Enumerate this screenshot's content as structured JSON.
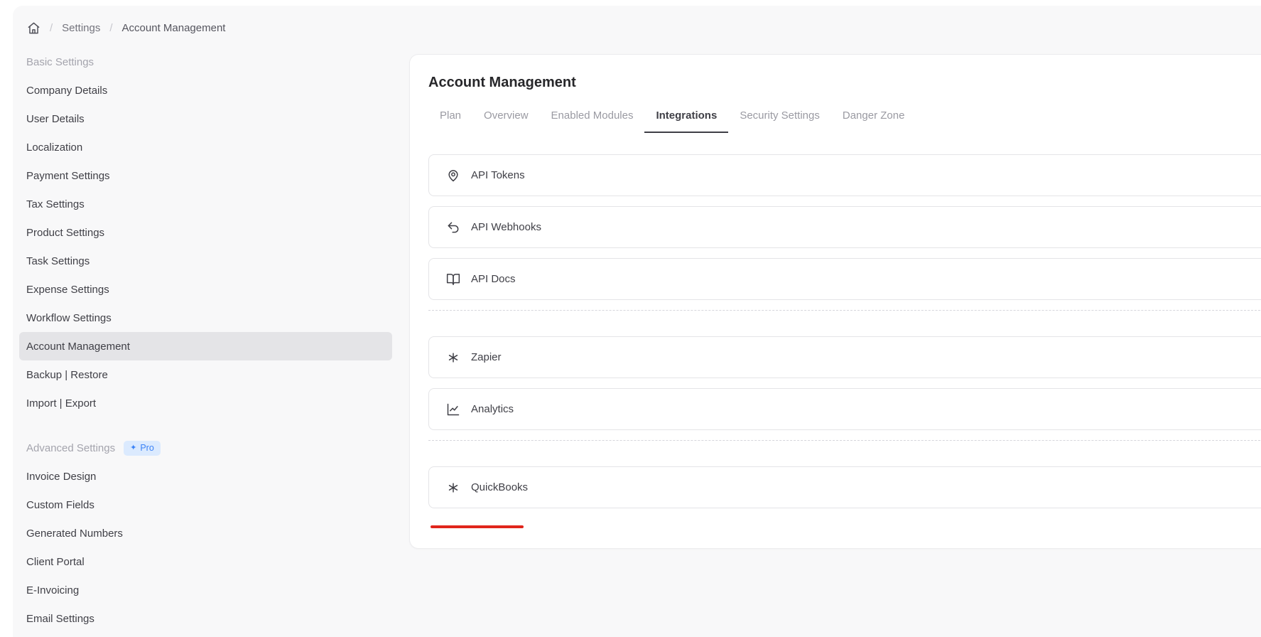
{
  "breadcrumb": {
    "separator": "/",
    "items": [
      "Settings",
      "Account Management"
    ]
  },
  "sidebar": {
    "sections": [
      {
        "title": "Basic Settings",
        "items": [
          "Company Details",
          "User Details",
          "Localization",
          "Payment Settings",
          "Tax Settings",
          "Product Settings",
          "Task Settings",
          "Expense Settings",
          "Workflow Settings",
          "Account Management",
          "Backup | Restore",
          "Import | Export"
        ],
        "active_item": "Account Management"
      },
      {
        "title": "Advanced Settings",
        "badge": {
          "label": "Pro",
          "icon": "sparkles-icon",
          "icon_glyph": "✦",
          "bg": "#dbeafe",
          "color": "#3b82f6"
        },
        "items": [
          "Invoice Design",
          "Custom Fields",
          "Generated Numbers",
          "Client Portal",
          "E-Invoicing",
          "Email Settings"
        ]
      }
    ]
  },
  "main": {
    "title": "Account Management",
    "tabs": [
      {
        "label": "Plan",
        "active": false
      },
      {
        "label": "Overview",
        "active": false
      },
      {
        "label": "Enabled Modules",
        "active": false
      },
      {
        "label": "Integrations",
        "active": true
      },
      {
        "label": "Security Settings",
        "active": false
      },
      {
        "label": "Danger Zone",
        "active": false
      }
    ],
    "integration_groups": [
      {
        "items": [
          {
            "label": "API Tokens",
            "icon": "api-tokens-icon"
          },
          {
            "label": "API Webhooks",
            "icon": "api-webhooks-icon"
          },
          {
            "label": "API Docs",
            "icon": "api-docs-icon"
          }
        ]
      },
      {
        "items": [
          {
            "label": "Zapier",
            "icon": "zapier-icon"
          },
          {
            "label": "Analytics",
            "icon": "analytics-icon"
          }
        ]
      },
      {
        "items": [
          {
            "label": "QuickBooks",
            "icon": "quickbooks-icon"
          }
        ]
      }
    ],
    "annotation": {
      "type": "red-underline",
      "target": "QuickBooks",
      "color": "#e0251b"
    }
  },
  "colors": {
    "page_bg": "#f8f8f9",
    "card_bg": "#ffffff",
    "active_tab_text": "#3f3f46",
    "inactive_tab_text": "#9a9aa2",
    "selected_item_bg": "#e4e4e7",
    "pro_badge_bg": "#dbeafe",
    "pro_badge_text": "#3b82f6",
    "annotation_red": "#e0251b"
  }
}
